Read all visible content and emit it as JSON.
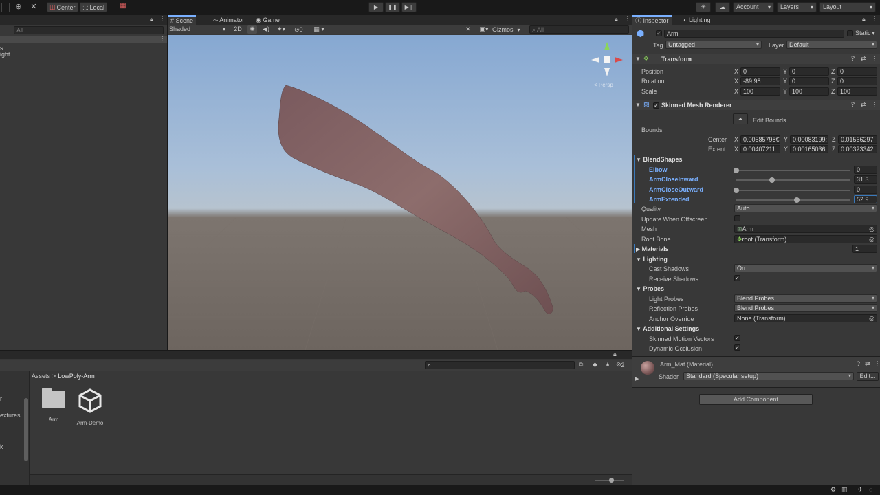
{
  "toolbar": {
    "center_label": "Center",
    "local_label": "Local",
    "account_label": "Account",
    "layers_label": "Layers",
    "layout_label": "Layout"
  },
  "hierarchy": {
    "search_placeholder": "All",
    "partial_items": [
      "s",
      "ight"
    ]
  },
  "scene": {
    "tabs": [
      {
        "label": "Scene"
      },
      {
        "label": "Animator"
      },
      {
        "label": "Game"
      }
    ],
    "shading_mode": "Shaded",
    "mode_2d": "2D",
    "hidden_count": "0",
    "gizmos_label": "Gizmos",
    "search_placeholder": "All",
    "persp_label": "< Persp"
  },
  "inspector": {
    "tabs": [
      {
        "label": "Inspector"
      },
      {
        "label": "Lighting"
      }
    ],
    "object_name": "Arm",
    "static_label": "Static",
    "tag_label": "Tag",
    "tag_value": "Untagged",
    "layer_label": "Layer",
    "layer_value": "Default",
    "transform": {
      "title": "Transform",
      "rows": [
        {
          "label": "Position",
          "x": "0",
          "y": "0",
          "z": "0"
        },
        {
          "label": "Rotation",
          "x": "-89.98",
          "y": "0",
          "z": "0"
        },
        {
          "label": "Scale",
          "x": "100",
          "y": "100",
          "z": "100"
        }
      ]
    },
    "smr": {
      "title": "Skinned Mesh Renderer",
      "edit_bounds": "Edit Bounds",
      "bounds_label": "Bounds",
      "center_label": "Center",
      "center": {
        "x": "0.00585798€",
        "y": "0.00083199:",
        "z": "0.01566297"
      },
      "extent_label": "Extent",
      "extent": {
        "x": "0.00407211:",
        "y": "0.00165036",
        "z": "0.00323342"
      },
      "blendshapes_label": "BlendShapes",
      "blendshapes": [
        {
          "label": "Elbow",
          "value": "0",
          "fraction": 0
        },
        {
          "label": "ArmCloseInward",
          "value": "31.3",
          "fraction": 0.313
        },
        {
          "label": "ArmCloseOutward",
          "value": "0",
          "fraction": 0
        },
        {
          "label": "ArmExtended",
          "value": "52.9",
          "fraction": 0.529
        }
      ],
      "quality_label": "Quality",
      "quality_value": "Auto",
      "update_offscreen_label": "Update When Offscreen",
      "mesh_label": "Mesh",
      "mesh_value": "Arm",
      "root_bone_label": "Root Bone",
      "root_bone_value": "root (Transform)",
      "materials_label": "Materials",
      "materials_count": "1",
      "lighting_label": "Lighting",
      "cast_shadows_label": "Cast Shadows",
      "cast_shadows_value": "On",
      "receive_shadows_label": "Receive Shadows",
      "probes_label": "Probes",
      "light_probes_label": "Light Probes",
      "light_probes_value": "Blend Probes",
      "reflection_probes_label": "Reflection Probes",
      "reflection_probes_value": "Blend Probes",
      "anchor_override_label": "Anchor Override",
      "anchor_override_value": "None (Transform)",
      "additional_label": "Additional Settings",
      "skinned_motion_label": "Skinned Motion Vectors",
      "dynamic_occlusion_label": "Dynamic Occlusion"
    },
    "material": {
      "name": "Arm_Mat (Material)",
      "shader_label": "Shader",
      "shader_value": "Standard (Specular setup)",
      "edit_label": "Edit..."
    },
    "add_component": "Add Component"
  },
  "project": {
    "breadcrumb_root": "Assets",
    "breadcrumb_current": "LowPoly-Arm",
    "hidden_count": "2",
    "items": [
      {
        "label": "Arm",
        "icon": "folder-icon"
      },
      {
        "label": "Arm-Demo",
        "icon": "unity-logo-icon"
      }
    ],
    "partial_sidebar": [
      "r",
      "extures",
      "k"
    ]
  },
  "colors": {
    "accent": "#7ab0ff",
    "selected_field_border": "#3a79bb",
    "sky_top": "#8fb0d6",
    "ground": "#6a625c",
    "arm_skin": "#8a6a6a"
  }
}
